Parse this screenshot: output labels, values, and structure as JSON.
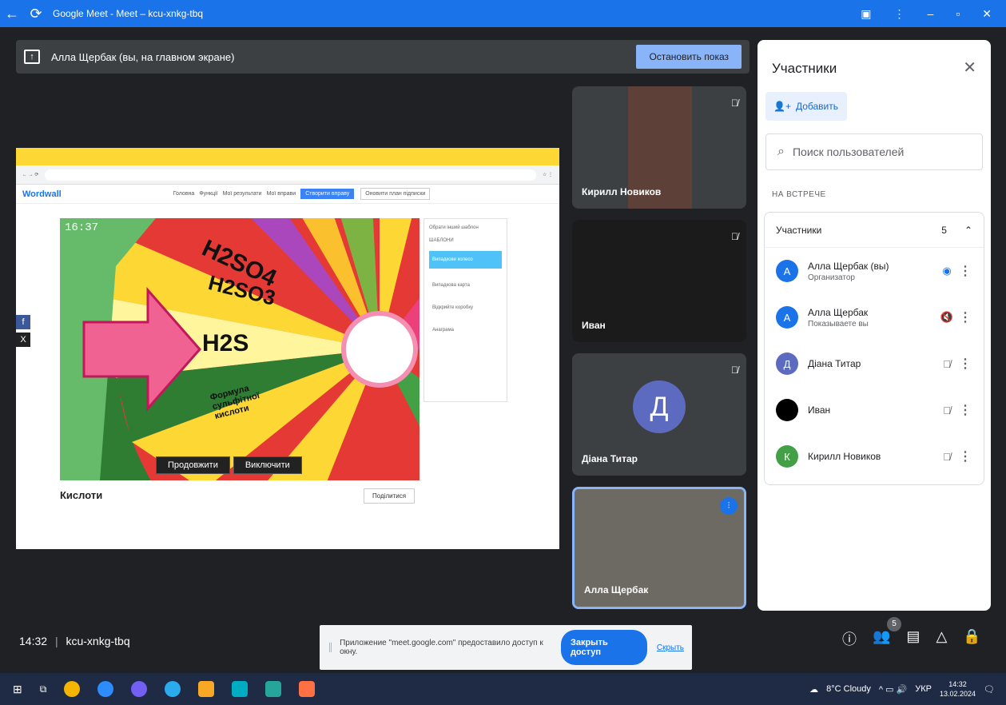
{
  "window": {
    "title": "Google Meet - Meet – kcu-xnkg-tbq"
  },
  "presenting": {
    "text": "Алла Щербак (вы, на главном экране)",
    "stop_label": "Остановить показ"
  },
  "shared": {
    "logo": "Wordwall",
    "nav": [
      "Головна",
      "Функції",
      "Мої результати",
      "Мої вправи"
    ],
    "create_label": "Створити вправу",
    "upgrade_label": "Оновити план підписки",
    "timer": "16:37",
    "wheel_segments": [
      "H2SO4",
      "H2SO3",
      "H2S",
      "Формула сульфітної кислоти"
    ],
    "continue_label": "Продовжити",
    "exclude_label": "Виключити",
    "templates_title": "Обрати інший шаблон",
    "templates_subtitle": "ШАБЛОНИ",
    "templates": [
      "Випадкове колесо",
      "Випадкова карта",
      "Відкрийте коробку",
      "Анаграма"
    ],
    "quiz_title": "Кислоти",
    "share_label": "Поділитися"
  },
  "tiles": [
    {
      "name": "Кирилл Новиков"
    },
    {
      "name": "Иван"
    },
    {
      "name": "Діана Титар",
      "initial": "Д"
    },
    {
      "name": "Алла Щербак"
    }
  ],
  "panel": {
    "title": "Участники",
    "add_label": "Добавить",
    "search_placeholder": "Поиск пользователей",
    "section": "НА ВСТРЕЧЕ",
    "group_label": "Участники",
    "count": "5",
    "participants": [
      {
        "name": "Алла Щербак (вы)",
        "role": "Организатор",
        "initial": "А",
        "color": "#1a73e8"
      },
      {
        "name": "Алла Щербак",
        "role": "Показываете вы",
        "initial": "А",
        "color": "#1a73e8"
      },
      {
        "name": "Діана Титар",
        "role": "",
        "initial": "Д",
        "color": "#5c6bc0"
      },
      {
        "name": "Иван",
        "role": "",
        "initial": "",
        "color": "#000000"
      },
      {
        "name": "Кирилл Новиков",
        "role": "",
        "initial": "К",
        "color": "#43a047"
      }
    ]
  },
  "bottom": {
    "time": "14:32",
    "code": "kcu-xnkg-tbq",
    "badge": "5"
  },
  "notice": {
    "text": "Приложение \"meet.google.com\" предоставило доступ к окну.",
    "close_label": "Закрыть доступ",
    "hide_label": "Скрыть"
  },
  "taskbar": {
    "weather": "8°C Cloudy",
    "lang": "УКР",
    "time": "14:32",
    "date": "13.02.2024"
  }
}
